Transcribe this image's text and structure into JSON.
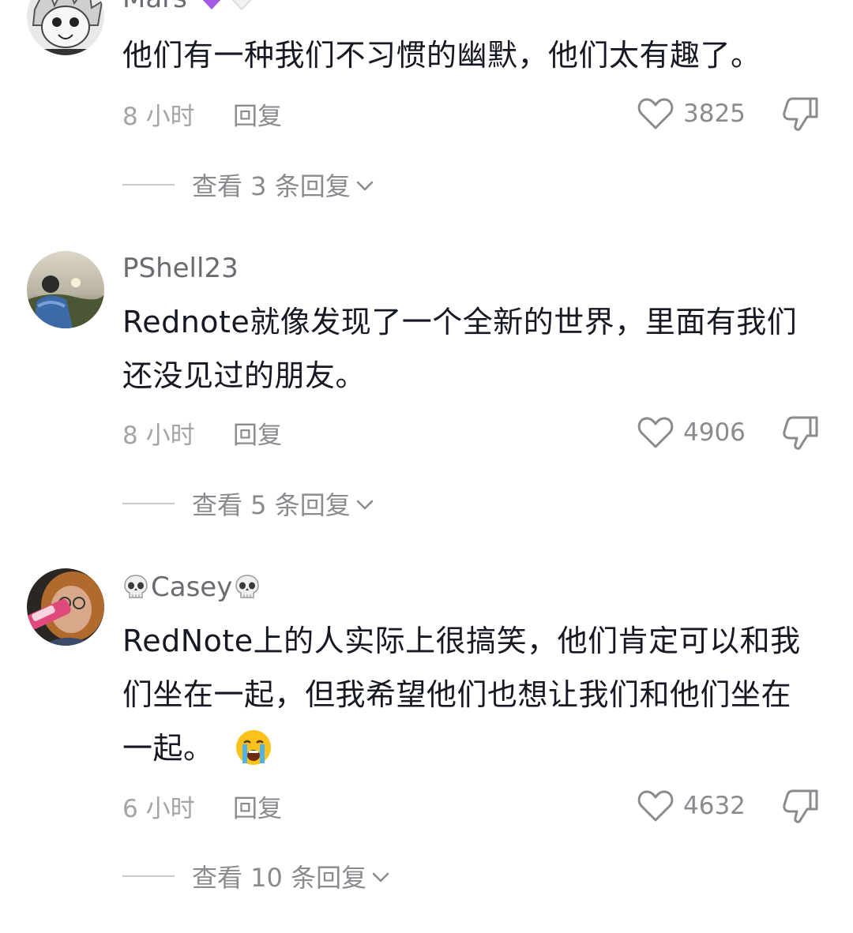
{
  "comments": [
    {
      "username": "Mars",
      "username_emojis": [
        "purple-heart",
        "white-heart"
      ],
      "text": "他们有一种我们不习惯的幽默，他们太有趣了。",
      "time": "8 小时",
      "reply_label": "回复",
      "likes": "3825",
      "view_replies": "查看 3 条回复"
    },
    {
      "username": "PShell23",
      "text": "Rednote就像发现了一个全新的世界，里面有我们还没见过的朋友。",
      "time": "8 小时",
      "reply_label": "回复",
      "likes": "4906",
      "view_replies": "查看 5 条回复"
    },
    {
      "username": "Casey",
      "username_emojis": [
        "skull",
        "skull"
      ],
      "text": "RedNote上的人实际上很搞笑，他们肯定可以和我们坐在一起，但我希望他们也想让我们和他们坐在一起。",
      "text_emoji": "loudly-crying-face",
      "time": "6 小时",
      "reply_label": "回复",
      "likes": "4632",
      "view_replies": "查看 10 条回复"
    }
  ],
  "colors": {
    "text_primary": "#161823",
    "text_secondary": "#8a8a8f",
    "username": "#6b6b72",
    "heart_purple": "#a259e6"
  },
  "icons": [
    "heart-outline-icon",
    "dislike-icon",
    "chevron-down-icon"
  ]
}
